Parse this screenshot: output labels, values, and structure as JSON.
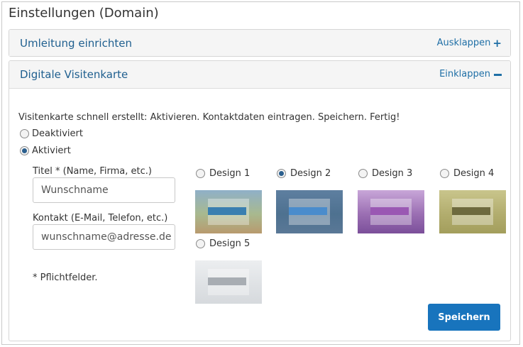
{
  "page": {
    "title": "Einstellungen (Domain)"
  },
  "panels": {
    "redirect": {
      "title": "Umleitung einrichten",
      "toggle_label": "Ausklappen",
      "icon": "plus-icon"
    },
    "card": {
      "title": "Digitale Visitenkarte",
      "toggle_label": "Einklappen",
      "icon": "minus-icon"
    }
  },
  "intro": "Visitenkarte schnell erstellt: Aktivieren. Kontaktdaten eintragen. Speichern. Fertig!",
  "status": {
    "options": [
      {
        "label": "Deaktiviert",
        "checked": false
      },
      {
        "label": "Aktiviert",
        "checked": true
      }
    ]
  },
  "form": {
    "title_label": "Titel * (Name, Firma, etc.)",
    "title_value": "Wunschname",
    "contact_label": "Kontakt (E-Mail, Telefon, etc.)",
    "contact_value": "wunschname@adresse.de",
    "required_note": "* Pflichtfelder."
  },
  "designs": [
    {
      "label": "Design 1",
      "checked": false,
      "colors": [
        "#8fb0c8",
        "#a8b98f",
        "#b89a6e"
      ],
      "strip": "#3a7fb0"
    },
    {
      "label": "Design 2",
      "checked": true,
      "colors": [
        "#5e7fa0",
        "#4e7190",
        "#5a7896"
      ],
      "strip": "#4a8ccc"
    },
    {
      "label": "Design 3",
      "checked": false,
      "colors": [
        "#c8a6d8",
        "#9b6fb3",
        "#7b4f9a"
      ],
      "strip": "#9a58b3"
    },
    {
      "label": "Design 4",
      "checked": false,
      "colors": [
        "#c9c58c",
        "#b2ad6e",
        "#a39e5c"
      ],
      "strip": "#6e6a3e"
    },
    {
      "label": "Design 5",
      "checked": false,
      "colors": [
        "#eceef0",
        "#dfe2e5",
        "#d6d9dd"
      ],
      "strip": "#a8adb3"
    }
  ],
  "actions": {
    "save_label": "Speichern"
  },
  "colors": {
    "accent": "#1874bd",
    "link": "#1f6fa6",
    "heading": "#1f5f8f"
  }
}
